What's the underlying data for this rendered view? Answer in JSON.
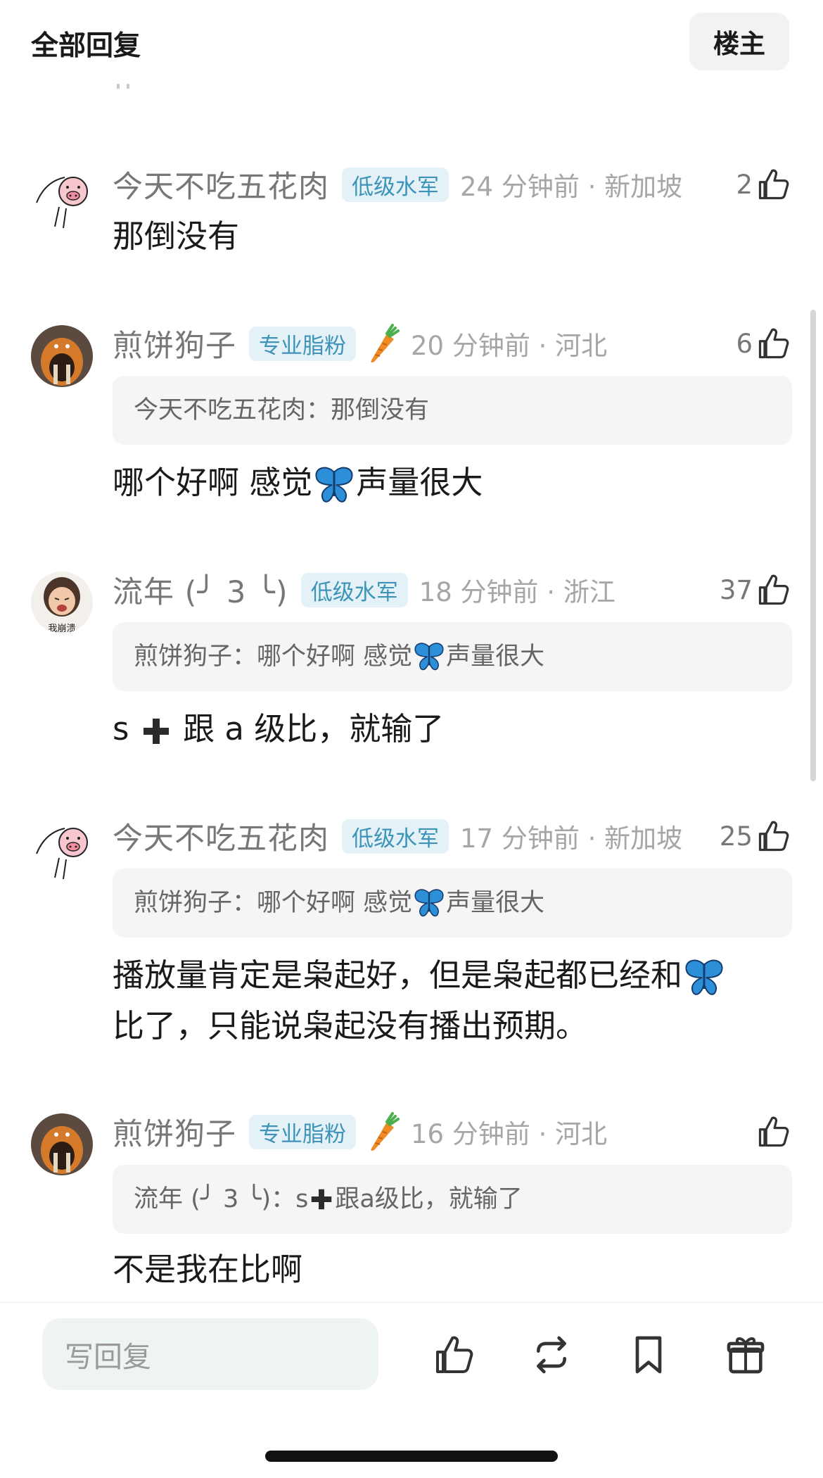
{
  "header": {
    "title": "全部回复",
    "op_button": "楼主"
  },
  "comments": [
    {
      "name": "今天不吃五花肉",
      "badge": "低级水军",
      "meta": "24 分钟前 · 新加坡",
      "likes": "2",
      "quote": null,
      "body": "那倒没有"
    },
    {
      "name": "煎饼狗子",
      "badge": "专业脂粉",
      "meta": "20 分钟前 · 河北",
      "likes": "6",
      "quote": {
        "author": "今天不吃五花肉：",
        "text": "那倒没有"
      },
      "body_parts": [
        "哪个好啊 感觉",
        "声量很大"
      ]
    },
    {
      "name": "流年 (╯ 3 ╰)",
      "badge": "低级水军",
      "meta": "18 分钟前 · 浙江",
      "likes": "37",
      "quote": {
        "author": "煎饼狗子：",
        "text_parts": [
          "哪个好啊 感觉",
          "声量很大"
        ]
      },
      "body_parts": [
        "s",
        "跟 a 级比，就输了"
      ]
    },
    {
      "name": "今天不吃五花肉",
      "badge": "低级水军",
      "meta": "17 分钟前 · 新加坡",
      "likes": "25",
      "quote": {
        "author": "煎饼狗子：",
        "text_parts": [
          "哪个好啊 感觉",
          "声量很大"
        ]
      },
      "body_parts": [
        "播放量肯定是枭起好，但是枭起都已经和",
        "比了，只能说枭起没有播出预期。"
      ]
    },
    {
      "name": "煎饼狗子",
      "badge": "专业脂粉",
      "meta": "16 分钟前 · 河北",
      "likes": "",
      "quote": {
        "author": "流年 (╯ 3 ╰)：",
        "text_parts": [
          "s",
          "跟a级比，就输了"
        ]
      },
      "body": "不是我在比啊"
    }
  ],
  "avatar_caption": "我崩溃",
  "bottom": {
    "reply_placeholder": "写回复"
  },
  "icons": [
    "thumbs-up-icon",
    "repost-icon",
    "bookmark-icon",
    "gift-icon",
    "butterfly-emoji",
    "carrot-emoji",
    "heavy-plus-emoji"
  ],
  "colors": {
    "badge_text": "#3d94b8",
    "badge_bg": "#e4f2f8",
    "meta": "#a6a6a6",
    "name": "#777777",
    "quote_bg": "#f5f5f5"
  }
}
